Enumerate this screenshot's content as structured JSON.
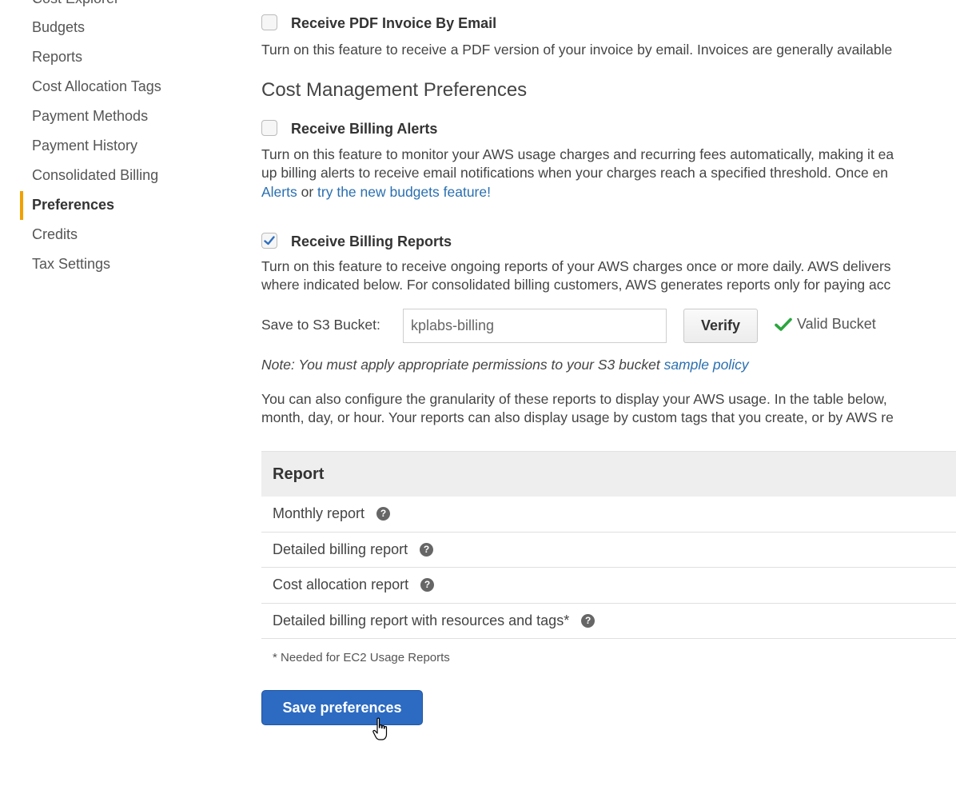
{
  "sidebar": {
    "items": [
      {
        "label": "Cost Explorer"
      },
      {
        "label": "Budgets"
      },
      {
        "label": "Reports"
      },
      {
        "label": "Cost Allocation Tags"
      },
      {
        "label": "Payment Methods"
      },
      {
        "label": "Payment History"
      },
      {
        "label": "Consolidated Billing"
      },
      {
        "label": "Preferences"
      },
      {
        "label": "Credits"
      },
      {
        "label": "Tax Settings"
      }
    ],
    "active": "Preferences"
  },
  "pdf_invoice": {
    "label": "Receive PDF Invoice By Email",
    "checked": false,
    "description": "Turn on this feature to receive a PDF version of your invoice by email. Invoices are generally available"
  },
  "cost_mgmt": {
    "title": "Cost Management Preferences",
    "billing_alerts": {
      "label": "Receive Billing Alerts",
      "checked": false,
      "line1": "Turn on this feature to monitor your AWS usage charges and recurring fees automatically, making it ea",
      "line2": "up billing alerts to receive email notifications when your charges reach a specified threshold. Once en",
      "link1": "Alerts",
      "or_text": " or ",
      "link2": "try the new budgets feature!"
    },
    "billing_reports": {
      "label": "Receive Billing Reports",
      "checked": true,
      "line1": "Turn on this feature to receive ongoing reports of your AWS charges once or more daily. AWS delivers",
      "line2": "where indicated below. For consolidated billing customers, AWS generates reports only for paying acc"
    }
  },
  "s3": {
    "label": "Save to S3 Bucket:",
    "value": "kplabs-billing",
    "verify_label": "Verify",
    "status": "Valid Bucket"
  },
  "note": {
    "text": "Note: You must apply appropriate permissions to your S3 bucket ",
    "link": "sample policy"
  },
  "granularity": {
    "line1": "You can also configure the granularity of these reports to display your AWS usage. In the table below,",
    "line2": "month, day, or hour. Your reports can also display usage by custom tags that you create, or by AWS re"
  },
  "report_table": {
    "header": "Report",
    "rows": [
      {
        "label": "Monthly report"
      },
      {
        "label": "Detailed billing report"
      },
      {
        "label": "Cost allocation report"
      },
      {
        "label": "Detailed billing report with resources and tags*"
      }
    ],
    "footnote": "* Needed for EC2 Usage Reports"
  },
  "save_button": "Save preferences",
  "colors": {
    "accent": "#f0a100",
    "link": "#2a6fb0",
    "primary_button": "#2d6bc2",
    "check": "#2aa63e"
  }
}
